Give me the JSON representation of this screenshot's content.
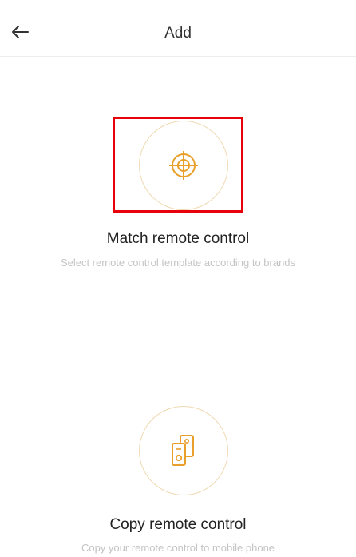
{
  "header": {
    "title": "Add",
    "back_icon": "arrow-left-icon"
  },
  "options": [
    {
      "title": "Match remote control",
      "description": "Select remote control template according to brands",
      "icon": "crosshair-icon"
    },
    {
      "title": "Copy remote control",
      "description": "Copy your remote control to mobile phone",
      "icon": "copy-remote-icon"
    }
  ],
  "colors": {
    "accent": "#e8a02a",
    "circle_border": "#f0d9b2",
    "highlight": "#e8000b",
    "muted_text": "#c4c4c4"
  }
}
